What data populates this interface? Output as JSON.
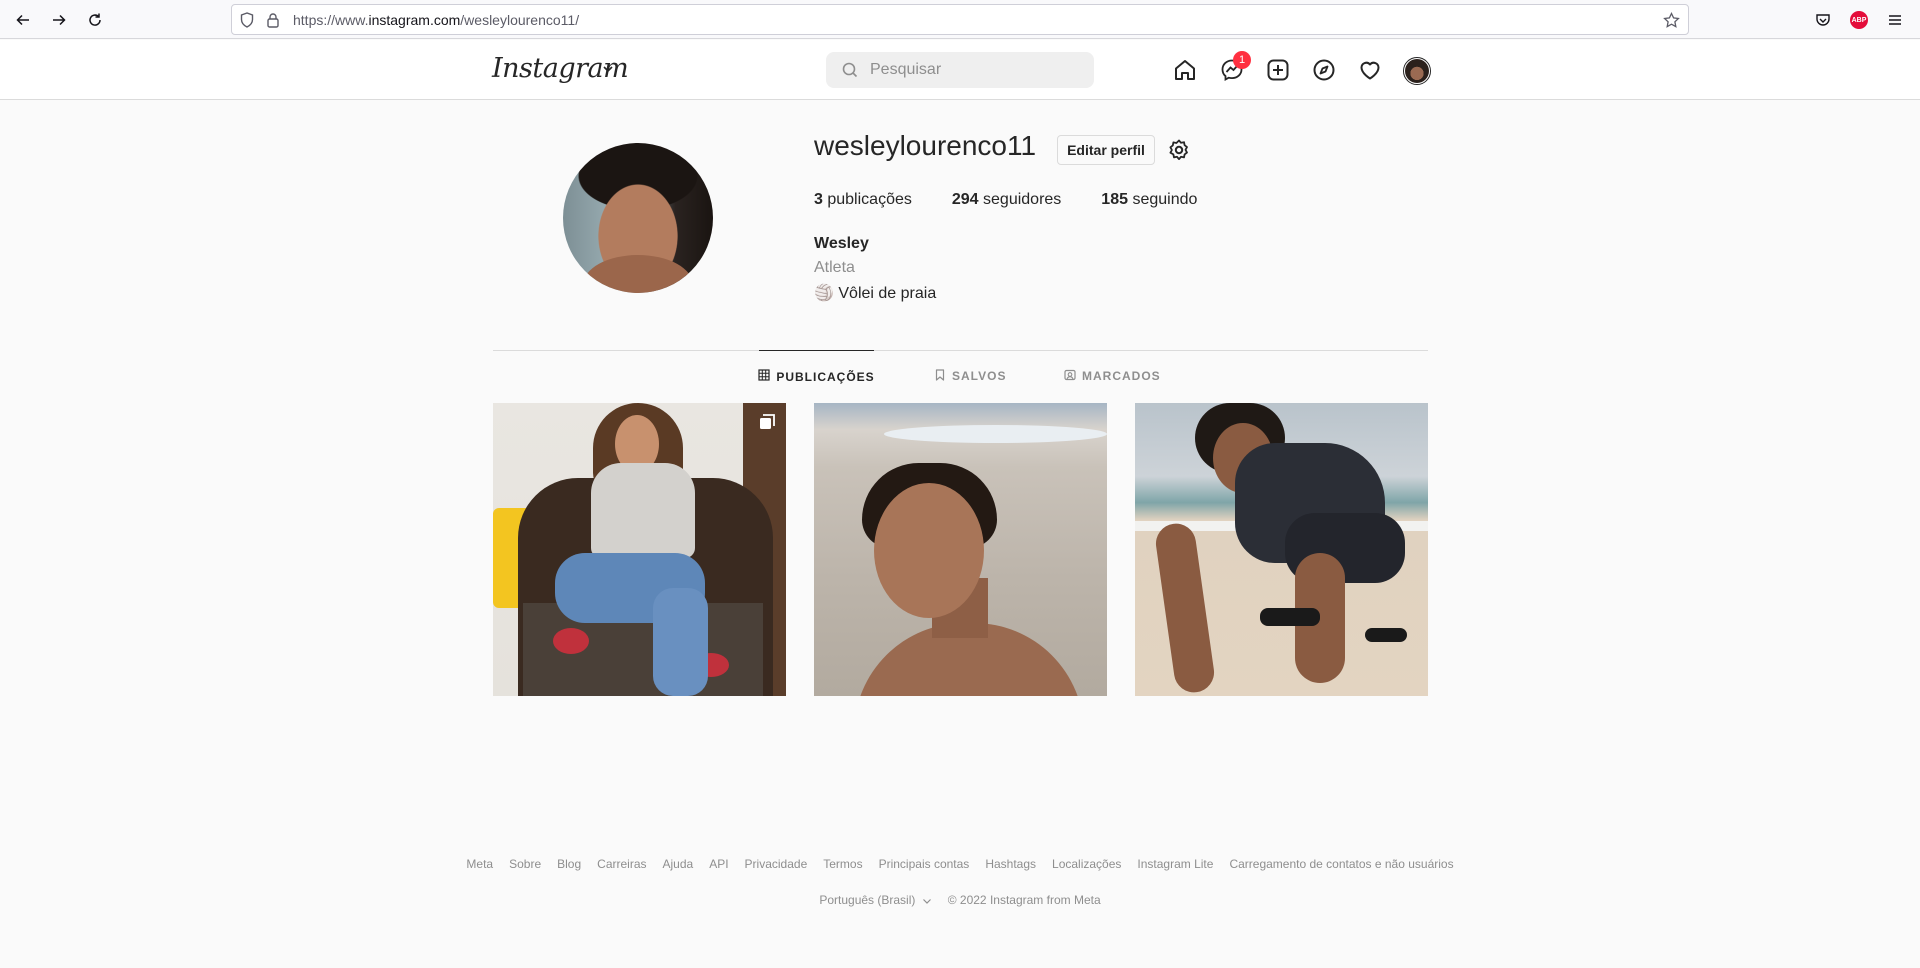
{
  "browser": {
    "url_prefix": "https://www.",
    "url_host": "instagram.com",
    "url_path": "/wesleylourenco11/",
    "abp_label": "ABP"
  },
  "header": {
    "logo": "Instagram",
    "search_placeholder": "Pesquisar",
    "messages_badge": "1"
  },
  "profile": {
    "username": "wesleylourenco11",
    "edit_button": "Editar perfil",
    "stats": {
      "posts_count": "3",
      "posts_label": "publicações",
      "followers_count": "294",
      "followers_label": "seguidores",
      "following_count": "185",
      "following_label": "seguindo"
    },
    "name": "Wesley",
    "category": "Atleta",
    "bio": "🏐 Vôlei de praia"
  },
  "tabs": [
    {
      "label": "PUBLICAÇÕES",
      "active": true
    },
    {
      "label": "SALVOS",
      "active": false
    },
    {
      "label": "MARCADOS",
      "active": false
    }
  ],
  "footer": {
    "links": [
      "Meta",
      "Sobre",
      "Blog",
      "Carreiras",
      "Ajuda",
      "API",
      "Privacidade",
      "Termos",
      "Principais contas",
      "Hashtags",
      "Localizações",
      "Instagram Lite",
      "Carregamento de contatos e não usuários"
    ],
    "language": "Português (Brasil)",
    "copyright": "© 2022 Instagram from Meta"
  }
}
